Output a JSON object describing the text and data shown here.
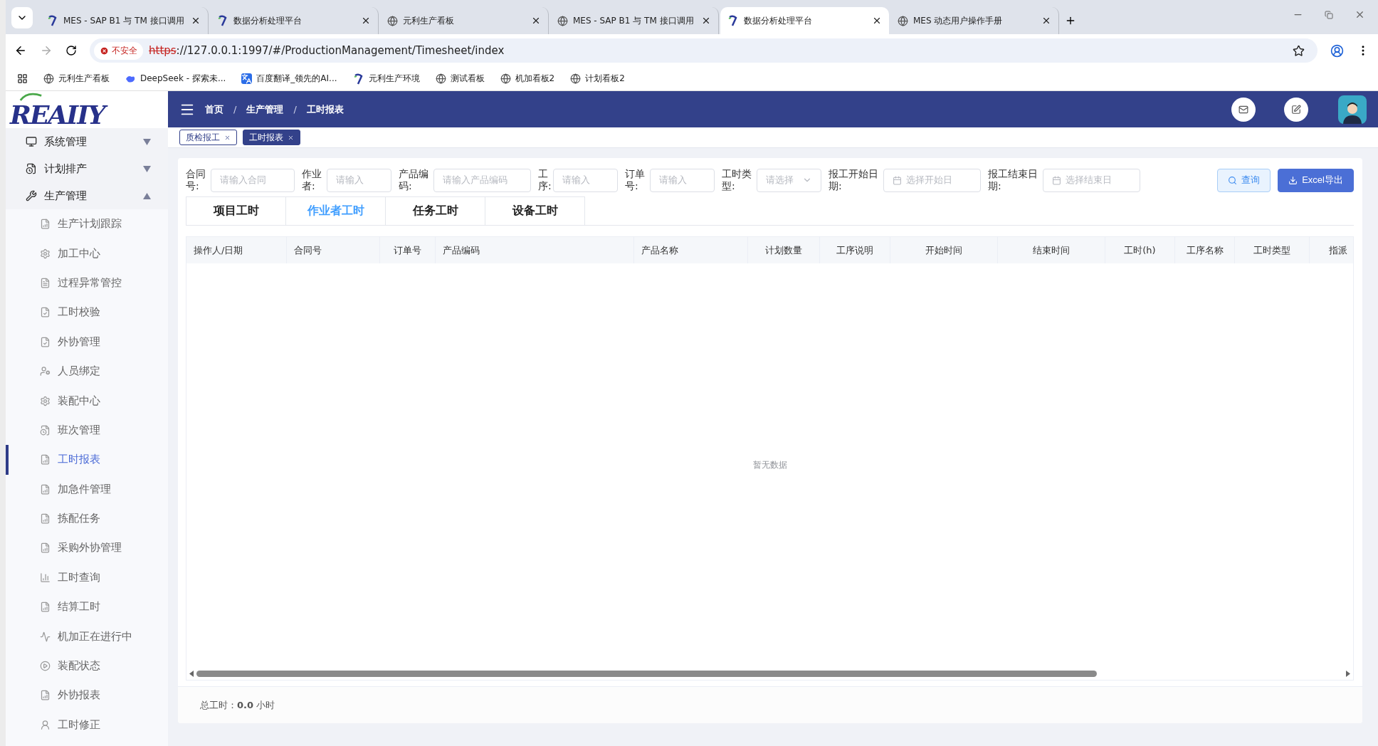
{
  "browser": {
    "tabs": [
      {
        "title": "MES - SAP B1 与 TM 接口调用",
        "selected": false
      },
      {
        "title": "数据分析处理平台",
        "selected": false
      },
      {
        "title": "元利生产看板",
        "selected": false
      },
      {
        "title": "MES - SAP B1 与 TM 接口调用",
        "selected": false
      },
      {
        "title": "数据分析处理平台",
        "selected": true
      },
      {
        "title": "MES 动态用户操作手册",
        "selected": false
      }
    ],
    "security": "不安全",
    "url_scheme": "https",
    "url_rest": "://127.0.0.1:1997/#/ProductionManagement/Timesheet/index",
    "bookmarks": [
      "元利生产看板",
      "DeepSeek - 探索未...",
      "百度翻译_领先的AI...",
      "元利生产环境",
      "测试看板",
      "机加看板2",
      "计划看板2"
    ]
  },
  "logo": "REAIIY",
  "sidebar": {
    "items": [
      {
        "label": "系统管理",
        "expanded": false
      },
      {
        "label": "计划排产",
        "expanded": false
      },
      {
        "label": "生产管理",
        "expanded": true,
        "children": [
          {
            "label": "生产计划跟踪",
            "selected": false
          },
          {
            "label": "加工中心",
            "selected": false
          },
          {
            "label": "过程异常管控",
            "selected": false
          },
          {
            "label": "工时校验",
            "selected": false
          },
          {
            "label": "外协管理",
            "selected": false
          },
          {
            "label": "人员绑定",
            "selected": false
          },
          {
            "label": "装配中心",
            "selected": false
          },
          {
            "label": "班次管理",
            "selected": false
          },
          {
            "label": "工时报表",
            "selected": true
          },
          {
            "label": "加急件管理",
            "selected": false
          },
          {
            "label": "拣配任务",
            "selected": false
          },
          {
            "label": "采购外协管理",
            "selected": false
          },
          {
            "label": "工时查询",
            "selected": false
          },
          {
            "label": "结算工时",
            "selected": false
          },
          {
            "label": "机加正在进行中",
            "selected": false
          },
          {
            "label": "装配状态",
            "selected": false
          },
          {
            "label": "外协报表",
            "selected": false
          },
          {
            "label": "工时修正",
            "selected": false
          }
        ]
      }
    ]
  },
  "breadcrumbs": [
    "首页",
    "生产管理",
    "工时报表"
  ],
  "breadcrumb_separators": [
    "/",
    "/"
  ],
  "tags": [
    {
      "label": "质检报工",
      "selected": false
    },
    {
      "label": "工时报表",
      "selected": true
    }
  ],
  "filters": [
    {
      "label": "合同号:",
      "kind": "text",
      "placeholder": "请输入合同"
    },
    {
      "label": "作业者:",
      "kind": "text",
      "placeholder": "请输入"
    },
    {
      "label": "产品编码:",
      "kind": "text",
      "placeholder": "请输入产品编码"
    },
    {
      "label": "工序:",
      "kind": "text",
      "placeholder": "请输入"
    },
    {
      "label": "订单号:",
      "kind": "text",
      "placeholder": "请输入"
    },
    {
      "label": "工时类型:",
      "kind": "select",
      "placeholder": "请选择"
    },
    {
      "label": "报工开始日期:",
      "kind": "date",
      "placeholder": "选择开始日"
    },
    {
      "label": "报工结束日期:",
      "kind": "date",
      "placeholder": "选择结束日"
    }
  ],
  "buttons": [
    {
      "label": "查询",
      "kind": "search"
    },
    {
      "label": "Excel导出",
      "kind": "export"
    }
  ],
  "view_tabs": [
    {
      "label": "项目工时",
      "selected": false
    },
    {
      "label": "作业者工时",
      "selected": true
    },
    {
      "label": "任务工时",
      "selected": false
    },
    {
      "label": "设备工时",
      "selected": false
    }
  ],
  "table": {
    "columns": [
      "操作人/日期",
      "合同号",
      "订单号",
      "产品编码",
      "产品名称",
      "计划数量",
      "工序说明",
      "开始时间",
      "结束时间",
      "工时(h)",
      "工序名称",
      "工时类型",
      "指派"
    ],
    "empty_text": "暂无数据"
  },
  "footer": "总工时：**0.0** 小时"
}
